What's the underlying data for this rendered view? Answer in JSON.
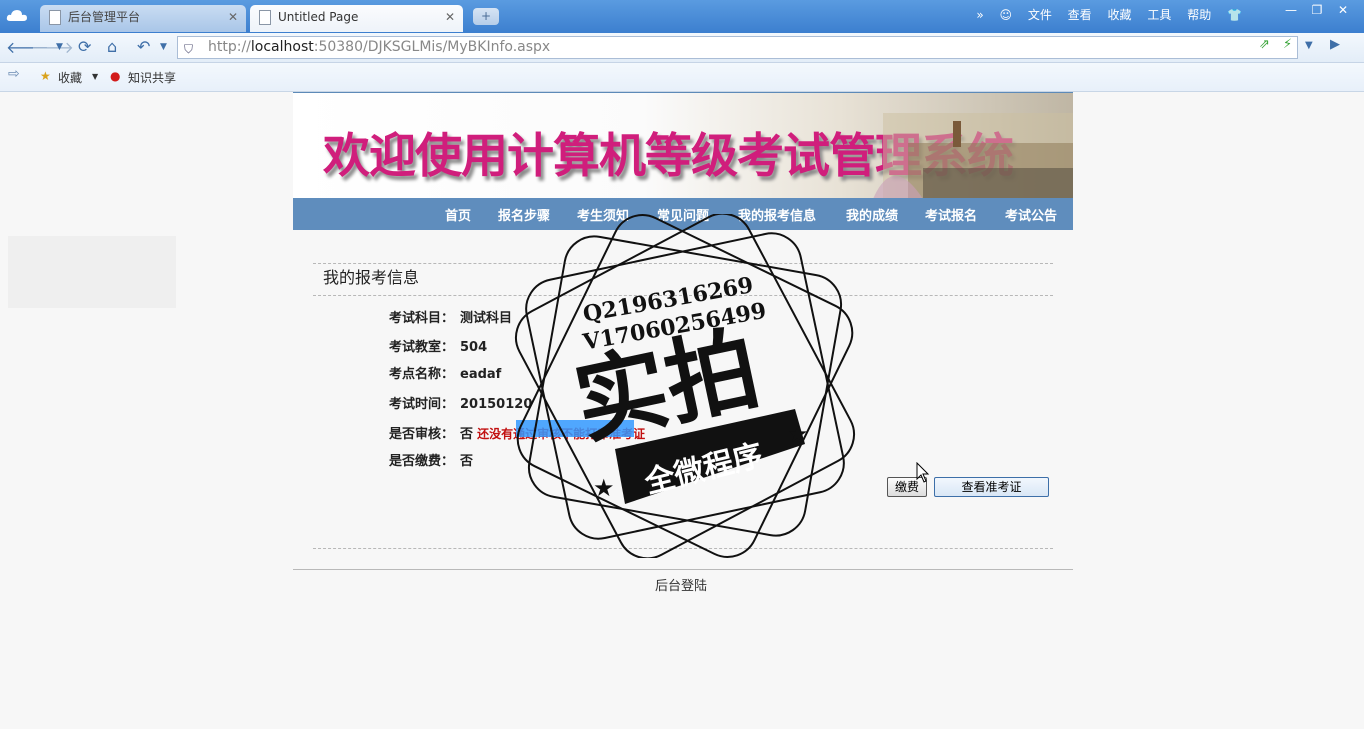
{
  "browser": {
    "tabs": [
      {
        "label": "后台管理平台",
        "active": false
      },
      {
        "label": "Untitled Page",
        "active": true
      }
    ],
    "top_menu": [
      "文件",
      "查看",
      "收藏",
      "工具",
      "帮助"
    ],
    "address": {
      "scheme": "http://",
      "host": "localhost",
      "rest": ":50380/DJKSGLMis/MyBKInfo.aspx"
    },
    "favorites": [
      {
        "label": "收藏",
        "icon": "star-add-icon"
      },
      {
        "label": "知识共享",
        "icon": "petrochina-icon"
      }
    ]
  },
  "page": {
    "banner_title": "欢迎使用计算机等级考试管理系统",
    "menu": [
      "首页",
      "报名步骤",
      "考生须知",
      "常见问题",
      "我的报考信息",
      "我的成绩",
      "考试报名",
      "考试公告"
    ],
    "section_title": "我的报考信息",
    "fields": [
      {
        "label": "考试科目：",
        "value": "测试科目"
      },
      {
        "label": "考试教室：",
        "value": "504"
      },
      {
        "label": "考点名称：",
        "value": "eadaf"
      },
      {
        "label": "考试时间：",
        "value": "20150120"
      },
      {
        "label": "是否审核：",
        "value": "否"
      },
      {
        "label": "是否缴费：",
        "value": "否"
      }
    ],
    "audit_warning": "还没有通过审核不能打印准考证",
    "buttons": {
      "pay": "缴费",
      "view_ticket": "查看准考证"
    },
    "footer_link": "后台登陆"
  },
  "watermark": {
    "line1": "Q2196316269",
    "line2": "V17060256499",
    "big": "实拍",
    "ribbon": "全微程序"
  },
  "colors": {
    "menubar": "#5f8dbd",
    "banner_text": "#d01e7c",
    "warning": "#c21010",
    "browser_blue": "#3c7fcf"
  }
}
